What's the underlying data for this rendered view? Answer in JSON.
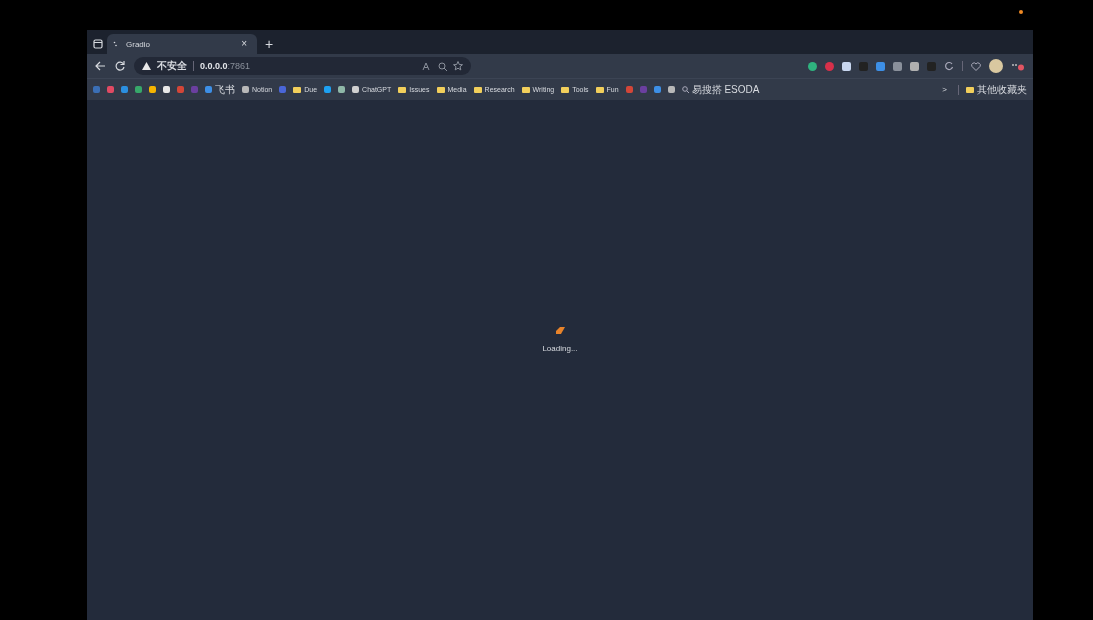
{
  "tab": {
    "title": "Gradio",
    "close": "×",
    "new_tab": "+"
  },
  "address_bar": {
    "security": "不安全",
    "host": "0.0.0.0",
    "port": ":7861"
  },
  "bookmarks": [
    {
      "kind": "icon"
    },
    {
      "kind": "icon"
    },
    {
      "kind": "icon"
    },
    {
      "kind": "icon"
    },
    {
      "kind": "icon"
    },
    {
      "kind": "icon"
    },
    {
      "kind": "icon"
    },
    {
      "kind": "icon"
    },
    {
      "kind": "site",
      "label": "飞书"
    },
    {
      "kind": "site",
      "label": "Notion"
    },
    {
      "kind": "icon"
    },
    {
      "kind": "folder",
      "label": "Due"
    },
    {
      "kind": "icon"
    },
    {
      "kind": "icon"
    },
    {
      "kind": "site",
      "label": "ChatGPT"
    },
    {
      "kind": "folder",
      "label": "Issues"
    },
    {
      "kind": "folder",
      "label": "Media"
    },
    {
      "kind": "folder",
      "label": "Research"
    },
    {
      "kind": "folder",
      "label": "Writing"
    },
    {
      "kind": "folder",
      "label": "Tools"
    },
    {
      "kind": "folder",
      "label": "Fun"
    },
    {
      "kind": "icon"
    },
    {
      "kind": "icon"
    },
    {
      "kind": "icon"
    },
    {
      "kind": "icon"
    },
    {
      "kind": "search",
      "label": "易搜搭 ESODA"
    }
  ],
  "bookmarks_more": ">",
  "other_bookmarks": "其他收藏夹",
  "loading": {
    "text": "Loading..."
  }
}
